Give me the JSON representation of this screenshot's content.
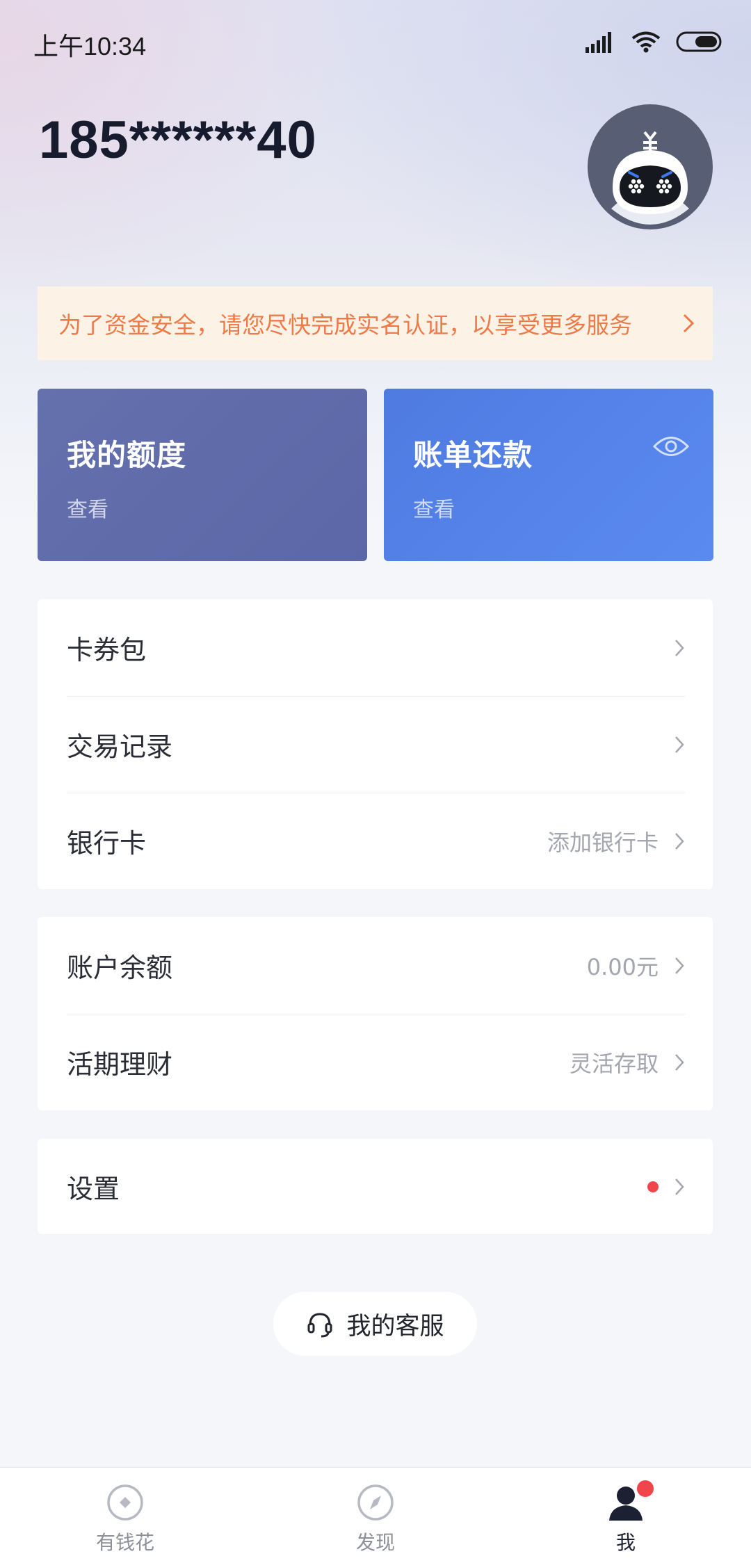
{
  "status_bar": {
    "time": "上午10:34",
    "icons": [
      "signal-icon",
      "wifi-icon",
      "battery-icon"
    ]
  },
  "header": {
    "phone": "185******40",
    "avatar_label": "¥"
  },
  "notice": {
    "text": "为了资金安全，请您尽快完成实名认证，以享受更多服务"
  },
  "cards": {
    "credit": {
      "title": "我的额度",
      "sub": "查看"
    },
    "bill": {
      "title": "账单还款",
      "sub": "查看"
    }
  },
  "group1": {
    "coupons": {
      "label": "卡券包"
    },
    "transactions": {
      "label": "交易记录"
    },
    "bank_card": {
      "label": "银行卡",
      "value": "添加银行卡"
    }
  },
  "group2": {
    "balance": {
      "label": "账户余额",
      "value": "0.00元"
    },
    "savings": {
      "label": "活期理财",
      "value": "灵活存取"
    }
  },
  "group3": {
    "settings": {
      "label": "设置"
    }
  },
  "service": {
    "label": "我的客服"
  },
  "tabbar": {
    "tabs": [
      {
        "label": "有钱花",
        "icon": "coin-icon"
      },
      {
        "label": "发现",
        "icon": "compass-icon"
      },
      {
        "label": "我",
        "icon": "user-icon"
      }
    ]
  },
  "colors": {
    "notice_text": "#ef7a48",
    "notice_bg": "#fcf3e6",
    "credit_card": "#5f6baa",
    "bill_card": "#5583e8",
    "badge_red": "#f0454a"
  }
}
